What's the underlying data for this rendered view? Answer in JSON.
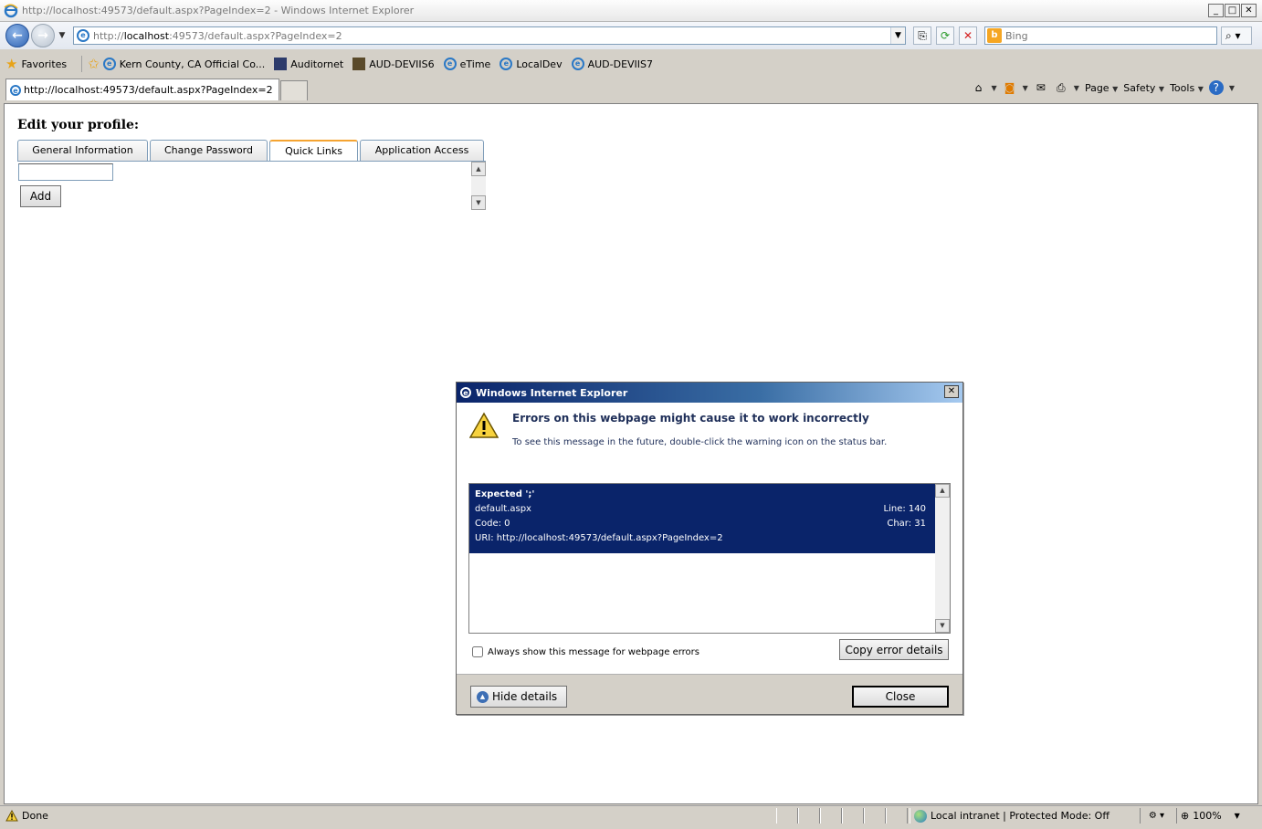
{
  "window": {
    "title": "http://localhost:49573/default.aspx?PageIndex=2 - Windows Internet Explorer"
  },
  "address": {
    "url_prefix": "http://",
    "url_host": "localhost",
    "url_rest": ":49573/default.aspx?PageIndex=2"
  },
  "search": {
    "placeholder": "Bing"
  },
  "favorites": {
    "label": "Favorites",
    "items": [
      {
        "label": "Kern County, CA Official Co...",
        "icon": "ie-page-icon"
      },
      {
        "label": "Auditornet",
        "icon": "auditornet-icon"
      },
      {
        "label": "AUD-DEVIIS6",
        "icon": "aud-icon"
      },
      {
        "label": "eTime",
        "icon": "ie-page-icon"
      },
      {
        "label": "LocalDev",
        "icon": "ie-page-icon"
      },
      {
        "label": "AUD-DEVIIS7",
        "icon": "ie-page-icon"
      }
    ]
  },
  "browser_tab": {
    "label": "http://localhost:49573/default.aspx?PageIndex=2"
  },
  "command_bar": {
    "page": "Page",
    "safety": "Safety",
    "tools": "Tools"
  },
  "profile": {
    "title": "Edit your profile:",
    "tabs": [
      {
        "label": "General Information",
        "active": false
      },
      {
        "label": "Change Password",
        "active": false
      },
      {
        "label": "Quick Links",
        "active": true
      },
      {
        "label": "Application Access",
        "active": false
      }
    ],
    "add_label": "Add",
    "link_value": ""
  },
  "dialog": {
    "title": "Windows Internet Explorer",
    "heading": "Errors on this webpage might cause it to work incorrectly",
    "subtext": "To see this message in the future, double-click the warning icon on the status bar.",
    "error": {
      "message": "Expected ';'",
      "file": "default.aspx",
      "line": "Line: 140",
      "code": "Code: 0",
      "char": "Char: 31",
      "uri": "URI: http://localhost:49573/default.aspx?PageIndex=2"
    },
    "always_show_label": "Always show this message for webpage errors",
    "always_show_checked": false,
    "copy_label": "Copy error details",
    "hide_label": "Hide details",
    "close_label": "Close"
  },
  "status": {
    "text": "Done",
    "zone": "Local intranet | Protected Mode: Off",
    "zoom": "100%"
  },
  "colors": {
    "accent_tab": "#f5a431",
    "error_selection": "#0a246a",
    "dialog_heading": "#1f2f59"
  }
}
